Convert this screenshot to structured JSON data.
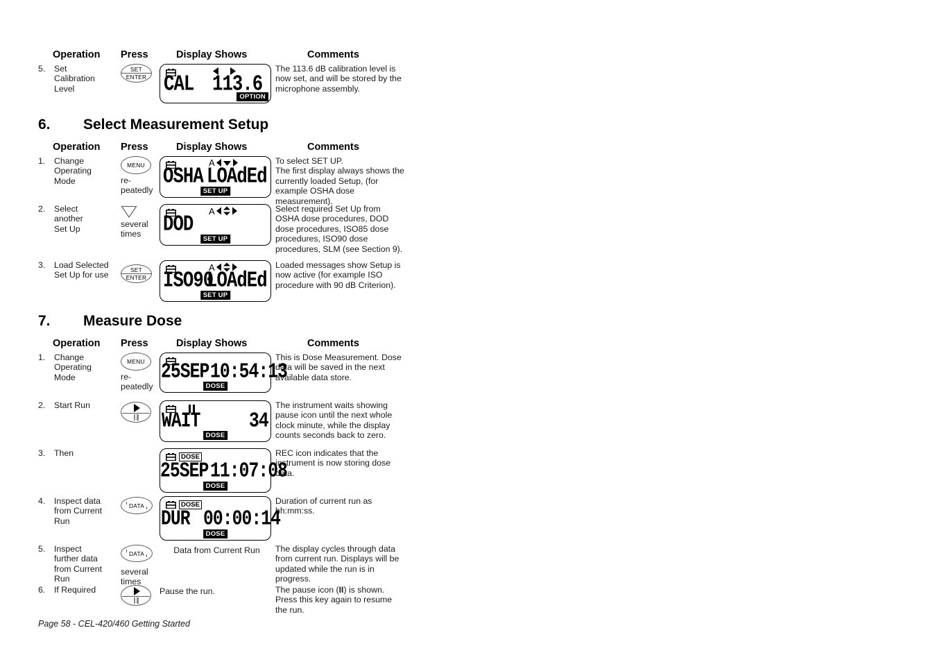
{
  "document": {
    "footer": "Page 58 - CEL-420/460 Getting Started"
  },
  "column_headers": {
    "operation": "Operation",
    "press": "Press",
    "display": "Display Shows",
    "comments": "Comments"
  },
  "section_top": {
    "rows": [
      {
        "num": "5.",
        "operation": "Set\nCalibration\nLevel",
        "press_key": "SET / ENTER",
        "press_key_line1": "SET",
        "press_key_line2": "ENTER",
        "press_sub": "",
        "display": {
          "battery": true,
          "rec": false,
          "pause": false,
          "arrows": "left-right",
          "arrow_letter": "",
          "left_text": "CAL",
          "right_text": "113.6",
          "badge": "OPTION",
          "badge_pos": "right"
        },
        "comments": "The 113.6 dB calibration level is now set, and will be stored by the microphone assembly."
      }
    ]
  },
  "section_6": {
    "number": "6.",
    "title": "Select Measurement Setup",
    "rows": [
      {
        "num": "1.",
        "operation": "Change\nOperating\nMode",
        "press_key": "MENU",
        "press_sub": "re-\npeatedly",
        "display": {
          "battery": true,
          "rec": false,
          "pause": false,
          "arrows": "a-left-down-right",
          "arrow_letter": "A",
          "left_text": "OSHA",
          "right_text": "LOAdEd",
          "badge": "SET UP",
          "badge_pos": "center"
        },
        "comments": "To select SET UP.\nThe first display always shows the currently loaded Setup, (for example OSHA dose measurement)."
      },
      {
        "num": "2.",
        "operation": "Select\nanother\nSet Up",
        "press_key": "down-triangle",
        "press_sub": "several\ntimes",
        "display": {
          "battery": true,
          "rec": false,
          "pause": false,
          "arrows": "a-left-updown-right",
          "arrow_letter": "A",
          "left_text": "DOD",
          "right_text": "",
          "badge": "SET UP",
          "badge_pos": "center"
        },
        "comments": "Select required Set Up from OSHA dose procedures, DOD dose procedures, ISO85 dose procedures, ISO90 dose procedures, SLM (see Section 9)."
      },
      {
        "num": "3.",
        "operation": "Load Selected\nSet Up for use",
        "press_key": "SET / ENTER",
        "press_key_line1": "SET",
        "press_key_line2": "ENTER",
        "press_sub": "",
        "display": {
          "battery": true,
          "rec": false,
          "pause": false,
          "arrows": "a-left-updown-right",
          "arrow_letter": "A",
          "left_text": "ISO90",
          "right_text": "LOAdEd",
          "badge": "SET UP",
          "badge_pos": "center"
        },
        "comments": "Loaded messages show Setup is now active (for example ISO procedure with 90 dB Criterion)."
      }
    ]
  },
  "section_7": {
    "number": "7.",
    "title": "Measure Dose",
    "rows": [
      {
        "num": "1.",
        "operation": "Change\nOperating\nMode",
        "press_key": "MENU",
        "press_sub": "re-\npeatedly",
        "display": {
          "battery": true,
          "rec": false,
          "pause": false,
          "arrows": "none",
          "arrow_letter": "",
          "left_text": "25SEP",
          "right_text": "10:54:13",
          "badge": "DOSE",
          "badge_pos": "center"
        },
        "comments": "This is Dose Measurement. Dose data will be saved in the next available data store."
      },
      {
        "num": "2.",
        "operation": "Start Run",
        "press_key": "play-pause",
        "press_sub": "",
        "display": {
          "battery": true,
          "rec": false,
          "pause": true,
          "arrows": "none",
          "arrow_letter": "",
          "left_text": "WAIT",
          "right_text": "34",
          "badge": "DOSE",
          "badge_pos": "center"
        },
        "comments": "The instrument waits showing pause icon until the next whole clock minute, while the display counts seconds back to zero."
      },
      {
        "num": "3.",
        "operation": "Then",
        "press_key": "",
        "press_sub": "",
        "display": {
          "battery": true,
          "rec": true,
          "pause": false,
          "arrows": "none",
          "arrow_letter": "",
          "left_text": "25SEP",
          "right_text": "11:07:08",
          "badge": "DOSE",
          "badge_pos": "center"
        },
        "comments": "REC icon indicates that the instrument is now storing dose data."
      },
      {
        "num": "4.",
        "operation": "Inspect data\nfrom Current\nRun",
        "press_key": "DATA",
        "press_sub": "",
        "display": {
          "battery": true,
          "rec": true,
          "pause": false,
          "arrows": "none",
          "arrow_letter": "",
          "left_text": "DUR",
          "right_text": "00:00:14",
          "badge": "DOSE",
          "badge_pos": "center"
        },
        "comments": "Duration of current run as hh:mm:ss."
      },
      {
        "num": "5.",
        "operation": "Inspect\nfurther data\nfrom Current\nRun",
        "press_key": "DATA",
        "press_sub": "several\ntimes",
        "display_text": "Data from Current Run",
        "comments": "The display cycles through data from current run. Displays will be updated while the run is in progress."
      },
      {
        "num": "6.",
        "operation": "If Required",
        "press_key": "play-pause",
        "press_sub": "",
        "display_text": "Pause the run.",
        "comments_pre": "The pause icon (",
        "comments_mark": "II",
        "comments_post": ") is shown. Press this key again to resume the run."
      }
    ]
  },
  "icon_names": {
    "battery": "battery-icon",
    "rec": "rec-icon",
    "pause": "pause-icon",
    "left_arrow": "left-arrow-icon",
    "right_arrow": "right-arrow-icon",
    "down_arrow": "down-arrow-icon",
    "updown_arrow": "up-down-arrow-icon",
    "play": "play-icon"
  }
}
